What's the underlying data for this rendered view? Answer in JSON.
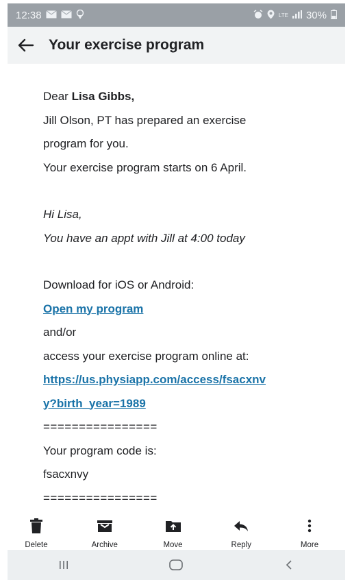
{
  "status_bar": {
    "time": "12:38",
    "network": "LTE",
    "battery": "30%"
  },
  "header": {
    "title": "Your exercise program"
  },
  "message": {
    "greeting_prefix": "Dear ",
    "recipient": "Lisa Gibbs,",
    "intro_line1": "Jill Olson, PT has prepared an exercise",
    "intro_line2": "program for you.",
    "start_line": "Your exercise program starts on 6 April.",
    "note_line1": "Hi Lisa,",
    "note_line2": "You have an appt with Jill at 4:00 today",
    "download_label": "Download for iOS or Android:",
    "open_link": "Open my program",
    "and_or": "and/or",
    "online_label": "access your exercise program online at:",
    "url_line1": "https://us.physiapp.com/access/fsacxnv",
    "url_line2": "y?birth_year=1989",
    "separator": "================",
    "code_label": "Your program code is:",
    "code": "fsacxnvy"
  },
  "actions": [
    {
      "label": "Delete",
      "icon": "trash-icon"
    },
    {
      "label": "Archive",
      "icon": "archive-icon"
    },
    {
      "label": "Move",
      "icon": "move-icon"
    },
    {
      "label": "Reply",
      "icon": "reply-icon"
    },
    {
      "label": "More",
      "icon": "more-vertical-icon"
    }
  ],
  "colors": {
    "link": "#1a73a8",
    "status_bar": "#9aa0a6",
    "app_bar": "#f1f3f4"
  }
}
